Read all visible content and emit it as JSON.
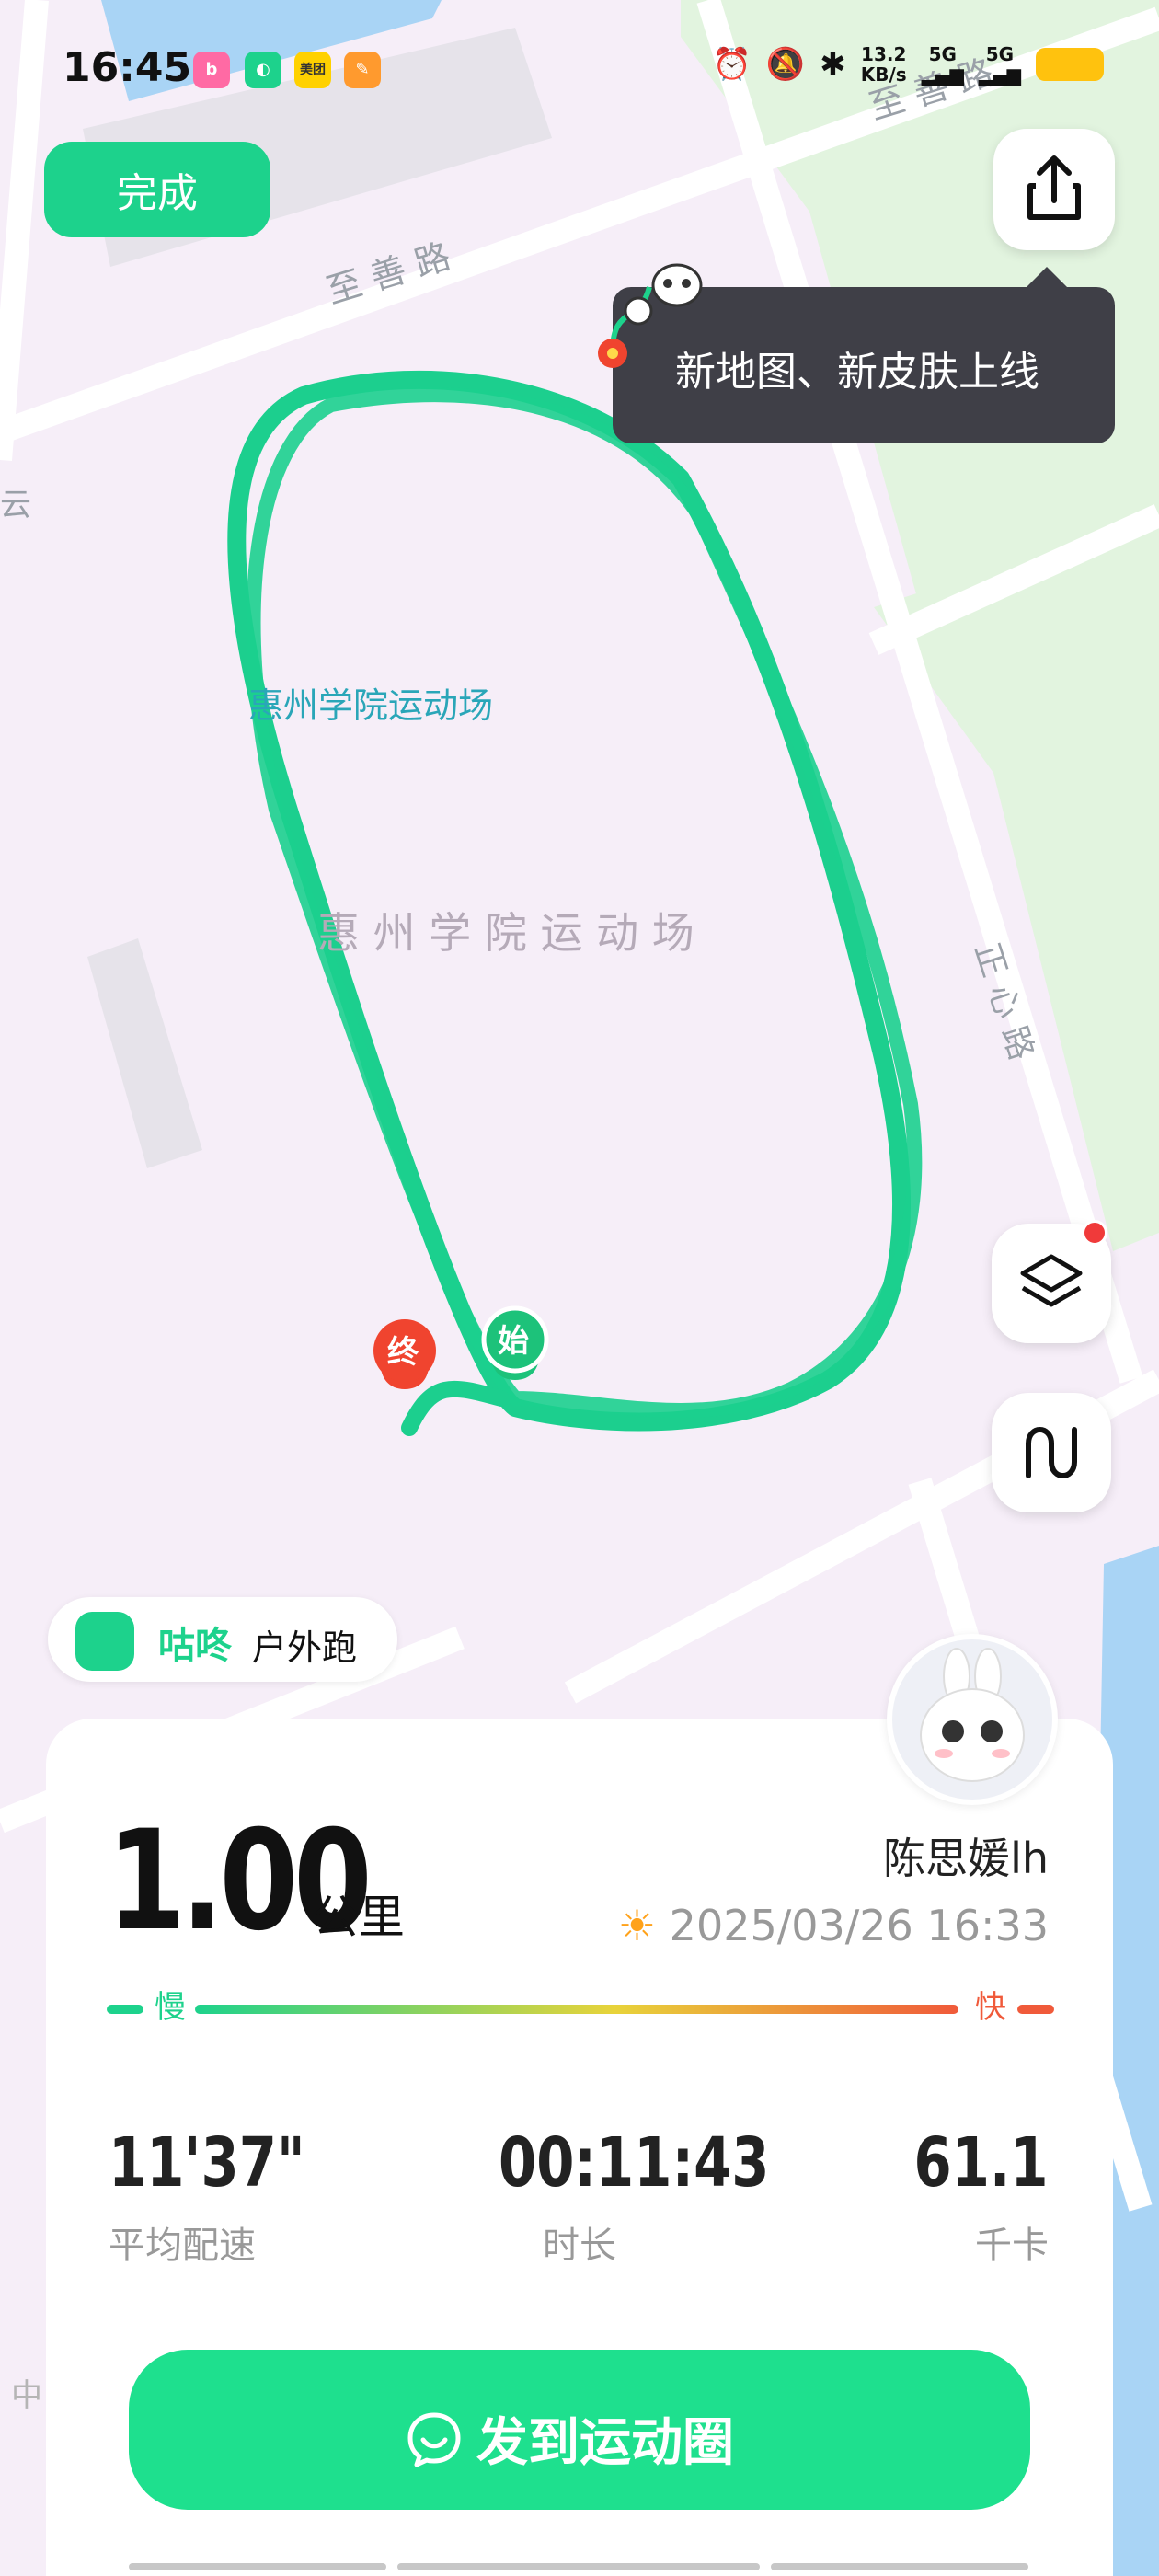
{
  "status_bar": {
    "time": "16:45",
    "apps": [
      "bilibili-icon",
      "gudong-icon",
      "meituan-icon",
      "notes-icon"
    ],
    "meituan_label": "美团",
    "net_speed": "13.2",
    "net_unit": "KB/s",
    "signal_label_1": "5G",
    "signal_label_2": "5G"
  },
  "toolbar": {
    "done_label": "完成"
  },
  "map": {
    "road_1": "至 善 路",
    "road_2": "至 善 路",
    "road_3": "正\n心\n路",
    "poi_label": "惠州学院运动场",
    "area_label": "惠 州 学 院 运 动 场",
    "edge_left_1": "云",
    "edge_left_2": "中",
    "start_marker": "始",
    "end_marker": "终"
  },
  "tooltip": {
    "text": "新地图、新皮肤上线"
  },
  "brand": {
    "name": "咕咚",
    "mode": "户外跑"
  },
  "summary": {
    "distance": "1.00",
    "distance_unit": "公里",
    "user_name": "陈思媛lh",
    "datetime": "2025/03/26 16:33",
    "pace_slow": "慢",
    "pace_fast": "快"
  },
  "stats": [
    {
      "value": "11'37\"",
      "label": "平均配速"
    },
    {
      "value": "00:11:43",
      "label": "时长"
    },
    {
      "value": "61.1",
      "label": "千卡"
    }
  ],
  "post_button": {
    "label": "发到运动圈"
  },
  "colors": {
    "accent": "#1dd28c",
    "track": "#1ccf8e",
    "tooltip_bg": "#3f3f47",
    "end_marker": "#f0442f"
  }
}
